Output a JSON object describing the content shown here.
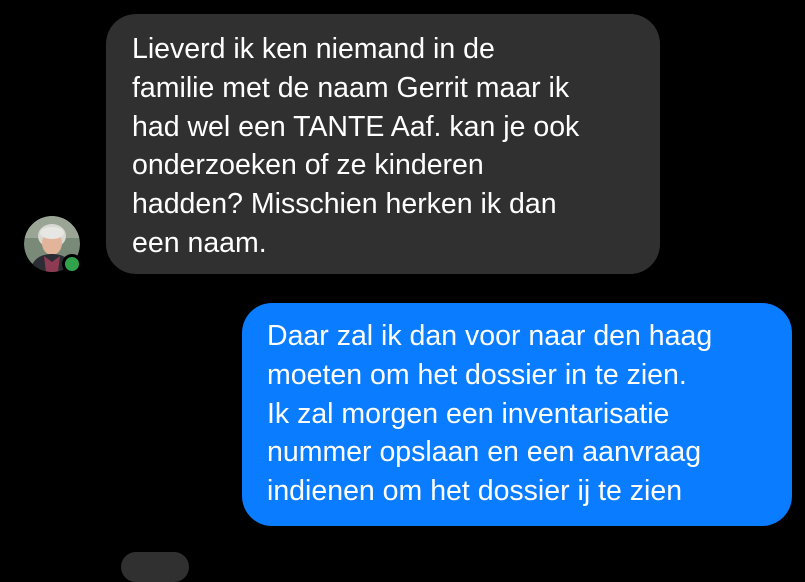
{
  "conversation": {
    "contact_avatar_icon": "person-avatar-icon",
    "online_status": "online",
    "online_status_color": "#31a24c",
    "messages": [
      {
        "direction": "incoming",
        "lines": [
          "Lieverd ik ken niemand in de",
          "familie met de naam Gerrit maar ik",
          "had wel een TANTE Aaf. kan je ook",
          "onderzoeken of ze kinderen",
          "hadden? Misschien herken ik dan",
          "een naam."
        ]
      },
      {
        "direction": "outgoing",
        "lines": [
          "Daar zal ik dan voor naar den haag",
          "moeten om het dossier in te zien.",
          "Ik zal morgen een inventarisatie",
          "nummer opslaan en een aanvraag",
          "indienen om het dossier ij te zien"
        ]
      }
    ]
  },
  "colors": {
    "background": "#000000",
    "incoming_bubble": "#303030",
    "outgoing_bubble": "#0a7cff",
    "text": "#ffffff"
  }
}
